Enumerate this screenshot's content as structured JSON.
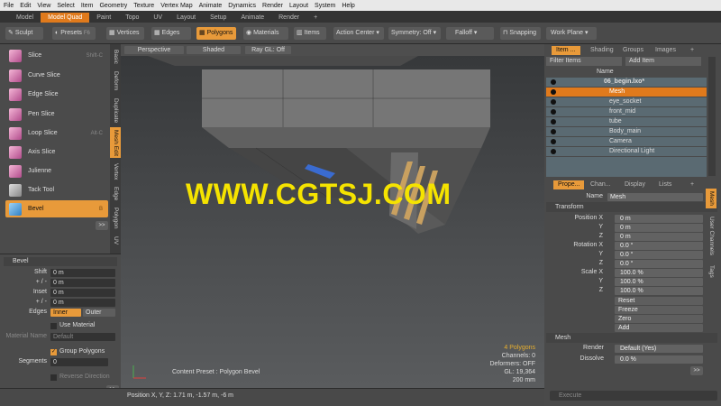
{
  "menubar": {
    "items": [
      "File",
      "Edit",
      "View",
      "Select",
      "Item",
      "Geometry",
      "Texture",
      "Vertex Map",
      "Animate",
      "Dynamics",
      "Render",
      "Layout",
      "System",
      "Help"
    ]
  },
  "layout_tabs": {
    "items": [
      "Model",
      "Model Quad",
      "Paint",
      "Topo",
      "UV",
      "Layout",
      "Setup",
      "Animate",
      "Render",
      "+"
    ],
    "active": "Model Quad"
  },
  "toolbar": {
    "sculpt": "Sculpt",
    "presets": "Presets",
    "presets_key": "F6",
    "vertices": "Vertices",
    "edges": "Edges",
    "polygons": "Polygons",
    "materials": "Materials",
    "items": "Items",
    "action_center": "Action Center",
    "symmetry": "Symmetry: Off",
    "falloff": "Falloff",
    "snapping": "Snapping",
    "work_plane": "Work Plane"
  },
  "tools": [
    {
      "label": "Slice",
      "shortcut": "Shift-C"
    },
    {
      "label": "Curve Slice",
      "shortcut": ""
    },
    {
      "label": "Edge Slice",
      "shortcut": ""
    },
    {
      "label": "Pen Slice",
      "shortcut": ""
    },
    {
      "label": "Loop Slice",
      "shortcut": "Alt-C"
    },
    {
      "label": "Axis Slice",
      "shortcut": ""
    },
    {
      "label": "Julienne",
      "shortcut": ""
    },
    {
      "label": "Tack Tool",
      "shortcut": ""
    },
    {
      "label": "Bevel",
      "shortcut": "B"
    }
  ],
  "vertical_tabs": [
    "Basic",
    "Deform",
    "Duplicate",
    "Mesh Edit",
    "Vertex",
    "Edge",
    "Polygon",
    "UV"
  ],
  "vertical_tabs_active": "Mesh Edit",
  "more_button": ">>",
  "bevel_panel": {
    "title": "Bevel",
    "shift_label": "Shift",
    "shift_value": "0 m",
    "pm1_label": "+ / -",
    "pm1_value": "0 m",
    "inset_label": "Inset",
    "inset_value": "0 m",
    "pm2_label": "+ / -",
    "pm2_value": "0 m",
    "edges_label": "Edges",
    "edges_inner": "Inner",
    "edges_outer": "Outer",
    "use_material": "Use Material",
    "material_name_label": "Material Name",
    "material_name_value": "Default",
    "group_polygons": "Group Polygons",
    "segments_label": "Segments",
    "segments_value": "0",
    "reverse_direction": "Reverse Direction"
  },
  "viewport": {
    "perspective": "Perspective",
    "shaded": "Shaded",
    "raygl": "Ray GL: Off",
    "watermark": "WWW.CGTSJ.COM",
    "content_preset": "Content Preset : Polygon Bevel",
    "stats": {
      "polygons": "4 Polygons",
      "channels": "Channels: 0",
      "deformers": "Deformers: OFF",
      "gl": "GL: 19,364",
      "unit": "200 mm"
    }
  },
  "statusbar": {
    "position": "Position X, Y, Z:  1.71 m, -1.57 m, -6 m"
  },
  "item_list": {
    "tabs": [
      "Item ...",
      "Shading",
      "Groups",
      "Images",
      "+"
    ],
    "filter": "Filter Items",
    "add_item": "Add Item",
    "name_header": "Name",
    "items": [
      {
        "name": "06_begin.lxo*",
        "selected": false
      },
      {
        "name": "Mesh",
        "selected": true
      },
      {
        "name": "eye_socket",
        "selected": false
      },
      {
        "name": "front_mid",
        "selected": false
      },
      {
        "name": "tube",
        "selected": false
      },
      {
        "name": "Body_main",
        "selected": false
      },
      {
        "name": "Camera",
        "selected": false
      },
      {
        "name": "Directional Light",
        "selected": false
      }
    ]
  },
  "properties": {
    "tabs": [
      "Prope...",
      "Chan...",
      "Display",
      "Lists",
      "+"
    ],
    "name_label": "Name",
    "name_value": "Mesh",
    "transform": "Transform",
    "position_label": "Position X",
    "px": "0 m",
    "py": "0 m",
    "pz": "0 m",
    "rotation_label": "Rotation X",
    "rx": "0.0 °",
    "ry": "0.0 °",
    "rz": "0.0 °",
    "scale_label": "Scale X",
    "sx": "100.0 %",
    "sy": "100.0 %",
    "sz": "100.0 %",
    "y_label": "Y",
    "z_label": "Z",
    "reset": "Reset",
    "freeze": "Freeze",
    "zero": "Zero",
    "add": "Add",
    "mesh_section": "Mesh",
    "render_label": "Render",
    "render_value": "Default (Yes)",
    "dissolve_label": "Dissolve",
    "dissolve_value": "0.0 %",
    "side_tabs": [
      "Mesh",
      "User Channels",
      "Tags"
    ],
    "side_active": "Mesh"
  },
  "command_placeholder": "Execute",
  "colors": {
    "accent": "#e89a3a",
    "selection": "#e07a1c",
    "watermark": "#f5e300"
  }
}
